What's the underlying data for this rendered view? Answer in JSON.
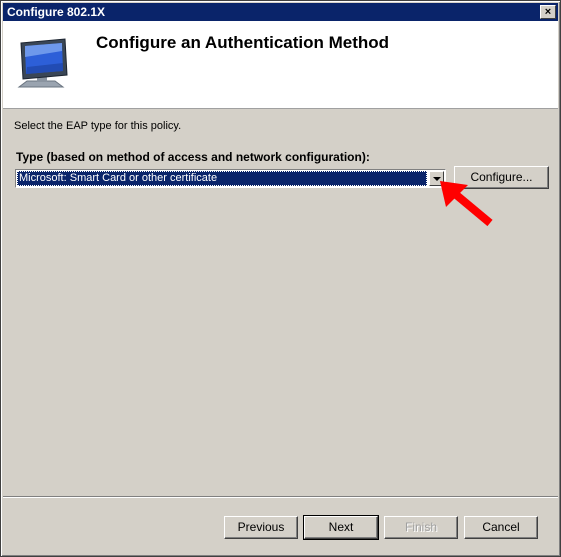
{
  "window": {
    "title": "Configure 802.1X",
    "close_glyph": "×"
  },
  "header": {
    "title": "Configure an Authentication Method",
    "icon": "computer-monitor-icon"
  },
  "main": {
    "instruction": "Select the EAP type for this policy.",
    "type_label": "Type (based on method of access and network configuration):",
    "eap_type_selected": "Microsoft: Smart Card or other certificate",
    "configure_label": "Configure..."
  },
  "annotation": {
    "arrow_color": "#ff0000"
  },
  "footer": {
    "previous_label": "Previous",
    "next_label": "Next",
    "finish_label": "Finish",
    "cancel_label": "Cancel"
  },
  "colors": {
    "titlebar": "#0a246a",
    "face": "#d4d0c8",
    "selection": "#0a246a"
  }
}
